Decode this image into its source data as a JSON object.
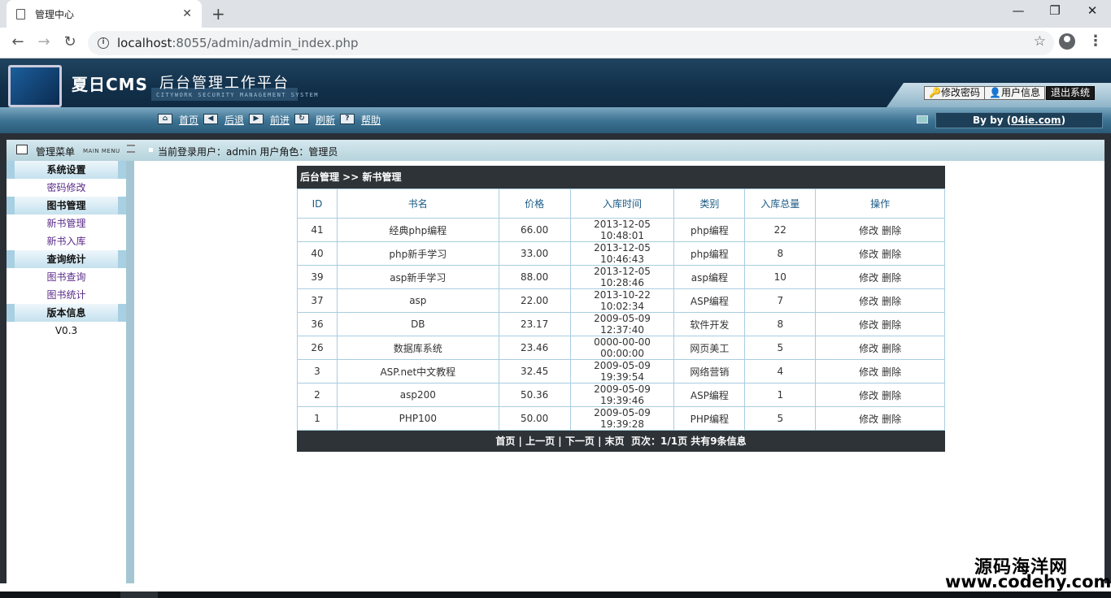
{
  "browser": {
    "tab_title": "管理中心",
    "tab_close": "✕",
    "new_tab": "+",
    "url_host": "localhost",
    "url_path": ":8055/admin/admin_index.php",
    "minimize": "—",
    "restore": "❐",
    "close": "✕",
    "back": "←",
    "forward": "→",
    "reload": "↻",
    "star": "☆",
    "menu": "⋮"
  },
  "header": {
    "logo": "夏日CMS",
    "subtitle": "后台管理工作平台",
    "tagline": "CITYWORK SECURITY MANAGEMENT SYSTEM",
    "change_password": "修改密码",
    "user_info": "用户信息",
    "logout": "退出系统"
  },
  "nav": {
    "home": "首页",
    "back": "后退",
    "forward": "前进",
    "refresh": "刷新",
    "help": "帮助",
    "byline_prefix": "By by (",
    "byline_link": "04ie.com",
    "byline_suffix": ")"
  },
  "strip": {
    "menu_title": "管理菜单",
    "menu_en": "MAIN MENU",
    "current_user": "当前登录用户：admin  用户角色：管理员"
  },
  "sidebar": {
    "groups": [
      {
        "title": "系统设置",
        "items": [
          "密码修改"
        ]
      },
      {
        "title": "图书管理",
        "items": [
          "新书管理",
          "新书入库"
        ]
      },
      {
        "title": "查询统计",
        "items": [
          "图书查询",
          "图书统计"
        ]
      },
      {
        "title": "版本信息",
        "items": []
      }
    ],
    "version": "V0.3"
  },
  "table": {
    "breadcrumb": "后台管理 >> 新书管理",
    "headers": [
      "ID",
      "书名",
      "价格",
      "入库时间",
      "类别",
      "入库总量",
      "操作"
    ],
    "edit_label": "修改",
    "delete_label": "删除",
    "rows": [
      [
        "41",
        "经典php编程",
        "66.00",
        "2013-12-05 10:48:01",
        "php编程",
        "22"
      ],
      [
        "40",
        "php新手学习",
        "33.00",
        "2013-12-05 10:46:43",
        "php编程",
        "8"
      ],
      [
        "39",
        "asp新手学习",
        "88.00",
        "2013-12-05 10:28:46",
        "asp编程",
        "10"
      ],
      [
        "37",
        "asp",
        "22.00",
        "2013-10-22 10:02:34",
        "ASP编程",
        "7"
      ],
      [
        "36",
        "DB",
        "23.17",
        "2009-05-09 12:37:40",
        "软件开发",
        "8"
      ],
      [
        "26",
        "数据库系统",
        "23.46",
        "0000-00-00 00:00:00",
        "网页美工",
        "5"
      ],
      [
        "3",
        "ASP.net中文教程",
        "32.45",
        "2009-05-09 19:39:54",
        "网络营销",
        "4"
      ],
      [
        "2",
        "asp200",
        "50.36",
        "2009-05-09 19:39:46",
        "ASP编程",
        "1"
      ],
      [
        "1",
        "PHP100",
        "50.00",
        "2009-05-09 19:39:28",
        "PHP编程",
        "5"
      ]
    ],
    "pager": {
      "first": "首页",
      "prev": "上一页",
      "next": "下一页",
      "last": "末页",
      "info": "页次：1/1页 共有9条信息"
    }
  },
  "watermark": {
    "line1": "源码海洋网",
    "line2": "www.codehy.com"
  }
}
